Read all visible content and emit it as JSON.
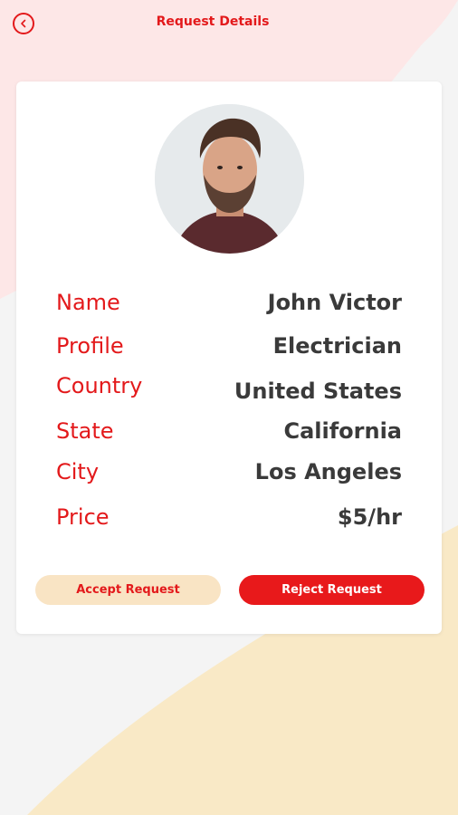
{
  "header": {
    "title": "Request Details",
    "back_icon": "chevron-left-circle-icon"
  },
  "profile": {
    "avatar_icon": "user-avatar",
    "fields": [
      {
        "label": "Name",
        "value": "John Victor"
      },
      {
        "label": "Profile",
        "value": "Electrician"
      },
      {
        "label": "Country",
        "value": "United States"
      },
      {
        "label": "State",
        "value": "California"
      },
      {
        "label": "City",
        "value": "Los Angeles"
      },
      {
        "label": "Price",
        "value": "$5/hr"
      }
    ]
  },
  "actions": {
    "accept_label": "Accept Request",
    "reject_label": "Reject Request"
  },
  "colors": {
    "accent": "#e3191b",
    "accept_bg": "#f9e4c4",
    "pink_bg": "#fde7e7",
    "cream_bg": "#f9e9c6"
  }
}
